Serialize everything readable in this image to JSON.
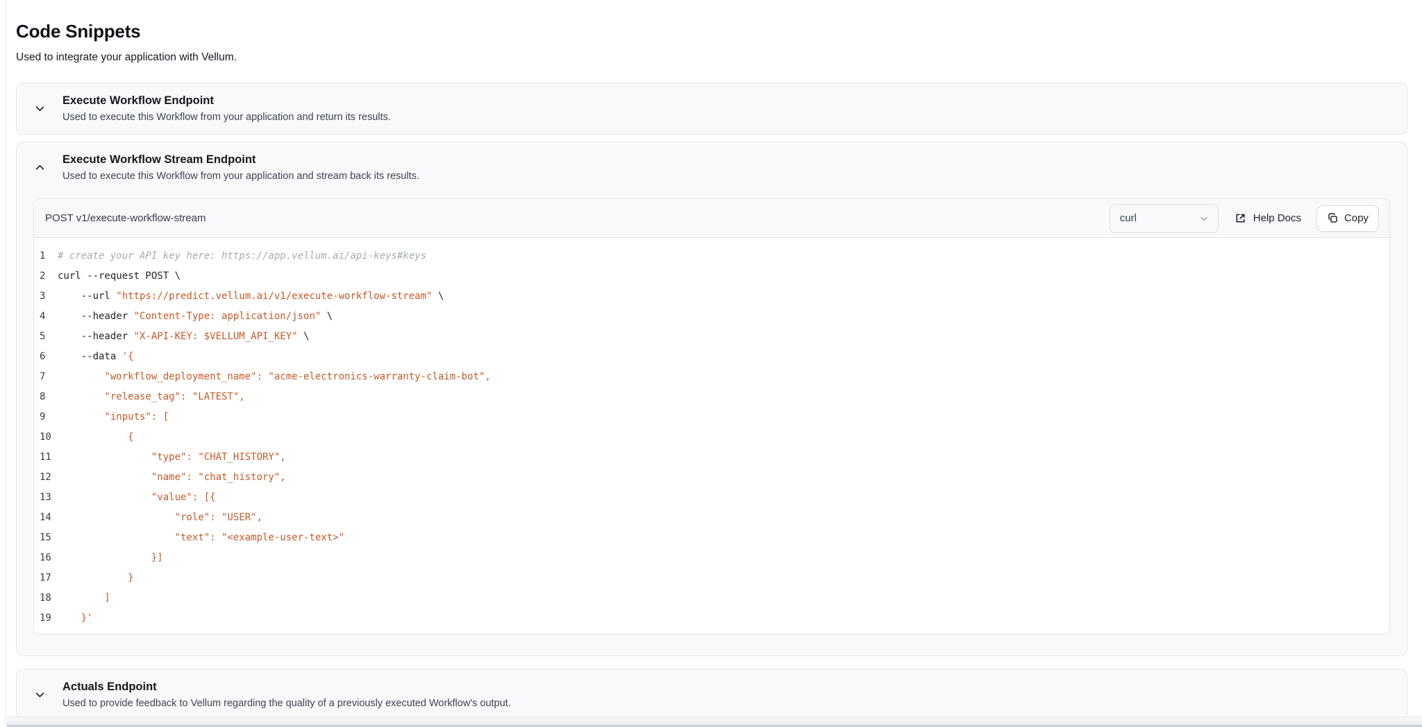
{
  "page": {
    "title": "Code Snippets",
    "subtitle": "Used to integrate your application with Vellum."
  },
  "sections": [
    {
      "title": "Execute Workflow Endpoint",
      "description": "Used to execute this Workflow from your application and return its results.",
      "expanded": false
    },
    {
      "title": "Execute Workflow Stream Endpoint",
      "description": "Used to execute this Workflow from your application and stream back its results.",
      "expanded": true
    },
    {
      "title": "Actuals Endpoint",
      "description": "Used to provide feedback to Vellum regarding the quality of a previously executed Workflow's output.",
      "expanded": false
    }
  ],
  "snippet": {
    "endpoint_label": "POST v1/execute-workflow-stream",
    "language_selector": {
      "value": "curl"
    },
    "help_docs_label": "Help Docs",
    "copy_label": "Copy",
    "code_lines": [
      {
        "num": "1",
        "segments": [
          {
            "t": "# create your API key here: https://app.vellum.ai/api-keys#keys",
            "c": "cm"
          }
        ]
      },
      {
        "num": "2",
        "segments": [
          {
            "t": "curl --request POST \\",
            "c": "pl"
          }
        ]
      },
      {
        "num": "3",
        "segments": [
          {
            "t": "    --url ",
            "c": "pl"
          },
          {
            "t": "\"https://predict.vellum.ai/v1/execute-workflow-stream\"",
            "c": "st"
          },
          {
            "t": " \\",
            "c": "pl"
          }
        ]
      },
      {
        "num": "4",
        "segments": [
          {
            "t": "    --header ",
            "c": "pl"
          },
          {
            "t": "\"Content-Type: application/json\"",
            "c": "st"
          },
          {
            "t": " \\",
            "c": "pl"
          }
        ]
      },
      {
        "num": "5",
        "segments": [
          {
            "t": "    --header ",
            "c": "pl"
          },
          {
            "t": "\"X-API-KEY: $VELLUM_API_KEY\"",
            "c": "st"
          },
          {
            "t": " \\",
            "c": "pl"
          }
        ]
      },
      {
        "num": "6",
        "segments": [
          {
            "t": "    --data ",
            "c": "pl"
          },
          {
            "t": "'{",
            "c": "st"
          }
        ]
      },
      {
        "num": "7",
        "segments": [
          {
            "t": "        \"workflow_deployment_name\": \"acme-electronics-warranty-claim-bot\",",
            "c": "st"
          }
        ]
      },
      {
        "num": "8",
        "segments": [
          {
            "t": "        \"release_tag\": \"LATEST\",",
            "c": "st"
          }
        ]
      },
      {
        "num": "9",
        "segments": [
          {
            "t": "        \"inputs\": [",
            "c": "st"
          }
        ]
      },
      {
        "num": "10",
        "segments": [
          {
            "t": "            {",
            "c": "st"
          }
        ]
      },
      {
        "num": "11",
        "segments": [
          {
            "t": "                \"type\": \"CHAT_HISTORY\",",
            "c": "st"
          }
        ]
      },
      {
        "num": "12",
        "segments": [
          {
            "t": "                \"name\": \"chat_history\",",
            "c": "st"
          }
        ]
      },
      {
        "num": "13",
        "segments": [
          {
            "t": "                \"value\": [{",
            "c": "st"
          }
        ]
      },
      {
        "num": "14",
        "segments": [
          {
            "t": "                    \"role\": \"USER\",",
            "c": "st"
          }
        ]
      },
      {
        "num": "15",
        "segments": [
          {
            "t": "                    \"text\": \"<example-user-text>\"",
            "c": "st"
          }
        ]
      },
      {
        "num": "16",
        "segments": [
          {
            "t": "                }]",
            "c": "st"
          }
        ]
      },
      {
        "num": "17",
        "segments": [
          {
            "t": "            }",
            "c": "st"
          }
        ]
      },
      {
        "num": "18",
        "segments": [
          {
            "t": "        ]",
            "c": "st"
          }
        ]
      },
      {
        "num": "19",
        "segments": [
          {
            "t": "    }'",
            "c": "st"
          }
        ]
      }
    ]
  },
  "colors": {
    "string_highlight": "#c55a28",
    "comment": "#a6abb3",
    "card_background": "#f8f9fa",
    "card_border": "#e5e7eb"
  }
}
